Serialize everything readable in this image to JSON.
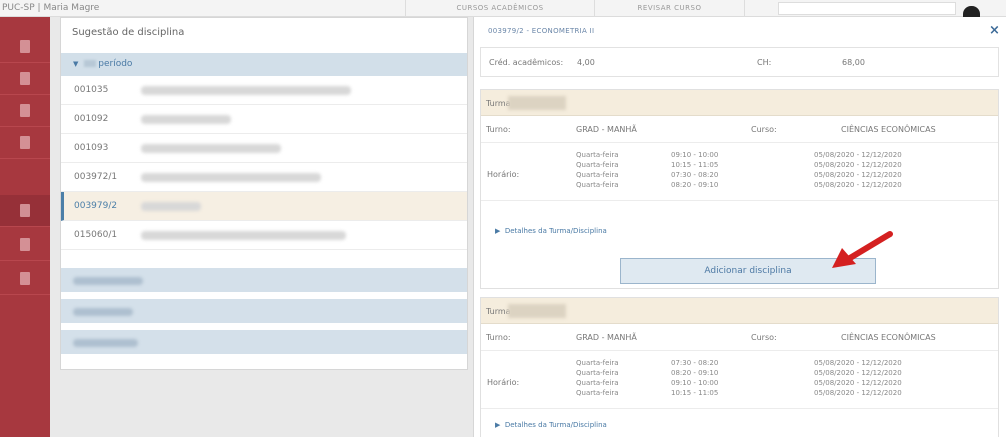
{
  "topbar": {
    "brand": "PUC-SP | Maria Magre",
    "tab1": "CURSOS ACADÊMICOS",
    "tab2": "REVISAR CURSO"
  },
  "left_panel": {
    "title": "Sugestão de disciplina",
    "period_label": "período",
    "courses": [
      {
        "code": "001035"
      },
      {
        "code": "001092"
      },
      {
        "code": "001093"
      },
      {
        "code": "003972/1"
      },
      {
        "code": "003979/2"
      },
      {
        "code": "015060/1"
      }
    ]
  },
  "right_panel": {
    "title": "003979/2 - ECONOMETRIA II",
    "close": "×",
    "cred_label": "Créd. acadêmicos:",
    "cred_value": "4,00",
    "ch_label": "CH:",
    "ch_value": "68,00",
    "cards": [
      {
        "turma_label": "Turma:",
        "turno_label": "Turno:",
        "turno_value": "GRAD - MANHÃ",
        "curso_label": "Curso:",
        "curso_value": "CIÊNCIAS ECONÔMICAS",
        "horario_label": "Horário:",
        "schedule": [
          {
            "day": "Quarta-feira",
            "time": "09:10 - 10:00",
            "period": "05/08/2020 - 12/12/2020"
          },
          {
            "day": "Quarta-feira",
            "time": "10:15 - 11:05",
            "period": "05/08/2020 - 12/12/2020"
          },
          {
            "day": "Quarta-feira",
            "time": "07:30 - 08:20",
            "period": "05/08/2020 - 12/12/2020"
          },
          {
            "day": "Quarta-feira",
            "time": "08:20 - 09:10",
            "period": "05/08/2020 - 12/12/2020"
          }
        ],
        "details_label": "Detalhes da Turma/Disciplina"
      },
      {
        "turma_label": "Turma:",
        "turno_label": "Turno:",
        "turno_value": "GRAD - MANHÃ",
        "curso_label": "Curso:",
        "curso_value": "CIÊNCIAS ECONÔMICAS",
        "horario_label": "Horário:",
        "schedule": [
          {
            "day": "Quarta-feira",
            "time": "07:30 - 08:20",
            "period": "05/08/2020 - 12/12/2020"
          },
          {
            "day": "Quarta-feira",
            "time": "08:20 - 09:10",
            "period": "05/08/2020 - 12/12/2020"
          },
          {
            "day": "Quarta-feira",
            "time": "09:10 - 10:00",
            "period": "05/08/2020 - 12/12/2020"
          },
          {
            "day": "Quarta-feira",
            "time": "10:15 - 11:05",
            "period": "05/08/2020 - 12/12/2020"
          }
        ],
        "details_label": "Detalhes da Turma/Disciplina"
      }
    ],
    "add_button": "Adicionar disciplina"
  },
  "colors": {
    "sidebar": "#a7383f",
    "accent": "#4c7fa8",
    "arrow": "#d42020"
  }
}
